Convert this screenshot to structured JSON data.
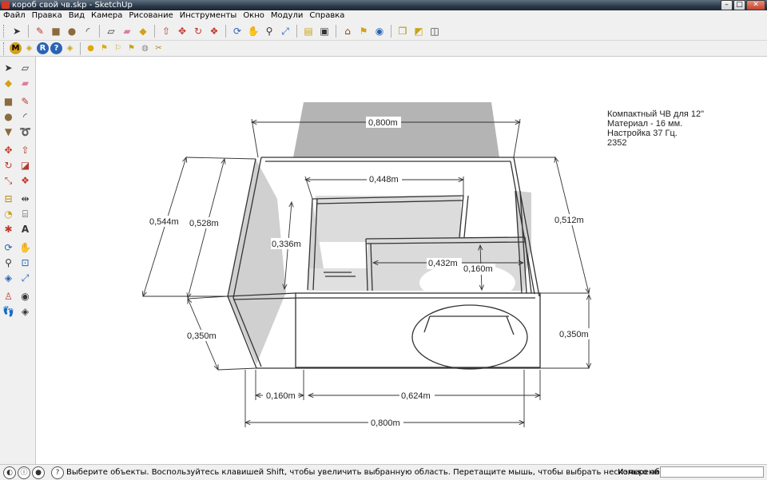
{
  "window": {
    "title": "короб свой чв.skp - SketchUp",
    "controls": [
      "minimize-icon",
      "maximize-icon",
      "close-icon"
    ]
  },
  "menu": [
    "Файл",
    "Правка",
    "Вид",
    "Камера",
    "Рисование",
    "Инструменты",
    "Окно",
    "Модули",
    "Справка"
  ],
  "toolbar1": {
    "icons": [
      "select-icon",
      "pencil-icon",
      "rectangle-icon",
      "circle-icon",
      "arc-icon",
      "make-component-icon",
      "eraser-icon",
      "paint-bucket-icon",
      "push-pull-icon",
      "move-icon",
      "rotate-icon",
      "offset-icon",
      "orbit-icon",
      "pan-icon",
      "zoom-icon",
      "zoom-extents-icon",
      "3d-warehouse-icon",
      "share-model-icon",
      "get-models-icon",
      "place-model-icon",
      "google-earth-icon",
      "components-icon",
      "styles-icon"
    ]
  },
  "toolbar2": {
    "icons": [
      "m-plugin-icon",
      "tag-plugin-icon",
      "r-plugin-icon",
      "help-plugin-icon",
      "tag2-plugin-icon",
      "sphere-icon",
      "flag-icon",
      "flag2-icon",
      "flag3-icon",
      "globe-icon",
      "scissors-icon"
    ]
  },
  "palette": {
    "icons": [
      "select-icon",
      "make-component-icon",
      "paint-bucket-icon",
      "eraser-icon",
      "rectangle-icon",
      "line-icon",
      "circle-icon",
      "arc-icon",
      "polygon-icon",
      "freehand-icon",
      "move-icon",
      "push-pull-icon",
      "rotate-icon",
      "follow-me-icon",
      "scale-icon",
      "offset-icon",
      "tape-measure-icon",
      "dimension-icon",
      "protractor-icon",
      "text-icon",
      "axes-icon",
      "3d-text-icon",
      "orbit-icon",
      "pan-icon",
      "zoom-icon",
      "zoom-window-icon",
      "previous-view-icon",
      "zoom-extents-icon",
      "position-camera-icon",
      "look-around-icon",
      "walk-icon",
      "section-plane-icon"
    ]
  },
  "note": {
    "lines": [
      "Компактный ЧВ для 12\"",
      "Материал - 16 мм.",
      "Настройка 37 Гц.",
      "2352"
    ]
  },
  "dimensions": {
    "top_width": "0,800m",
    "inner_wall": "0,448m",
    "left_height": "0,544m",
    "left_depth": "0,528m",
    "inner_height": "0,336m",
    "right_height": "0,512m",
    "shelf": "0,432m",
    "shelf_gap": "0,160m",
    "front_height_left": "0,350m",
    "front_height_right": "0,350m",
    "bottom_small": "0,160m",
    "bottom_mid": "0,624m",
    "bottom_total": "0,800m"
  },
  "status": {
    "hint": "Выберите объекты. Воспользуйтесь клавишей Shift, чтобы увеличить выбранную область. Перетащите мышь, чтобы выбрать несколько об",
    "measure_label": "Измерения",
    "measure_value": "",
    "icons": [
      "geo-location-icon",
      "credits-icon",
      "user-icon",
      "help-icon"
    ]
  }
}
